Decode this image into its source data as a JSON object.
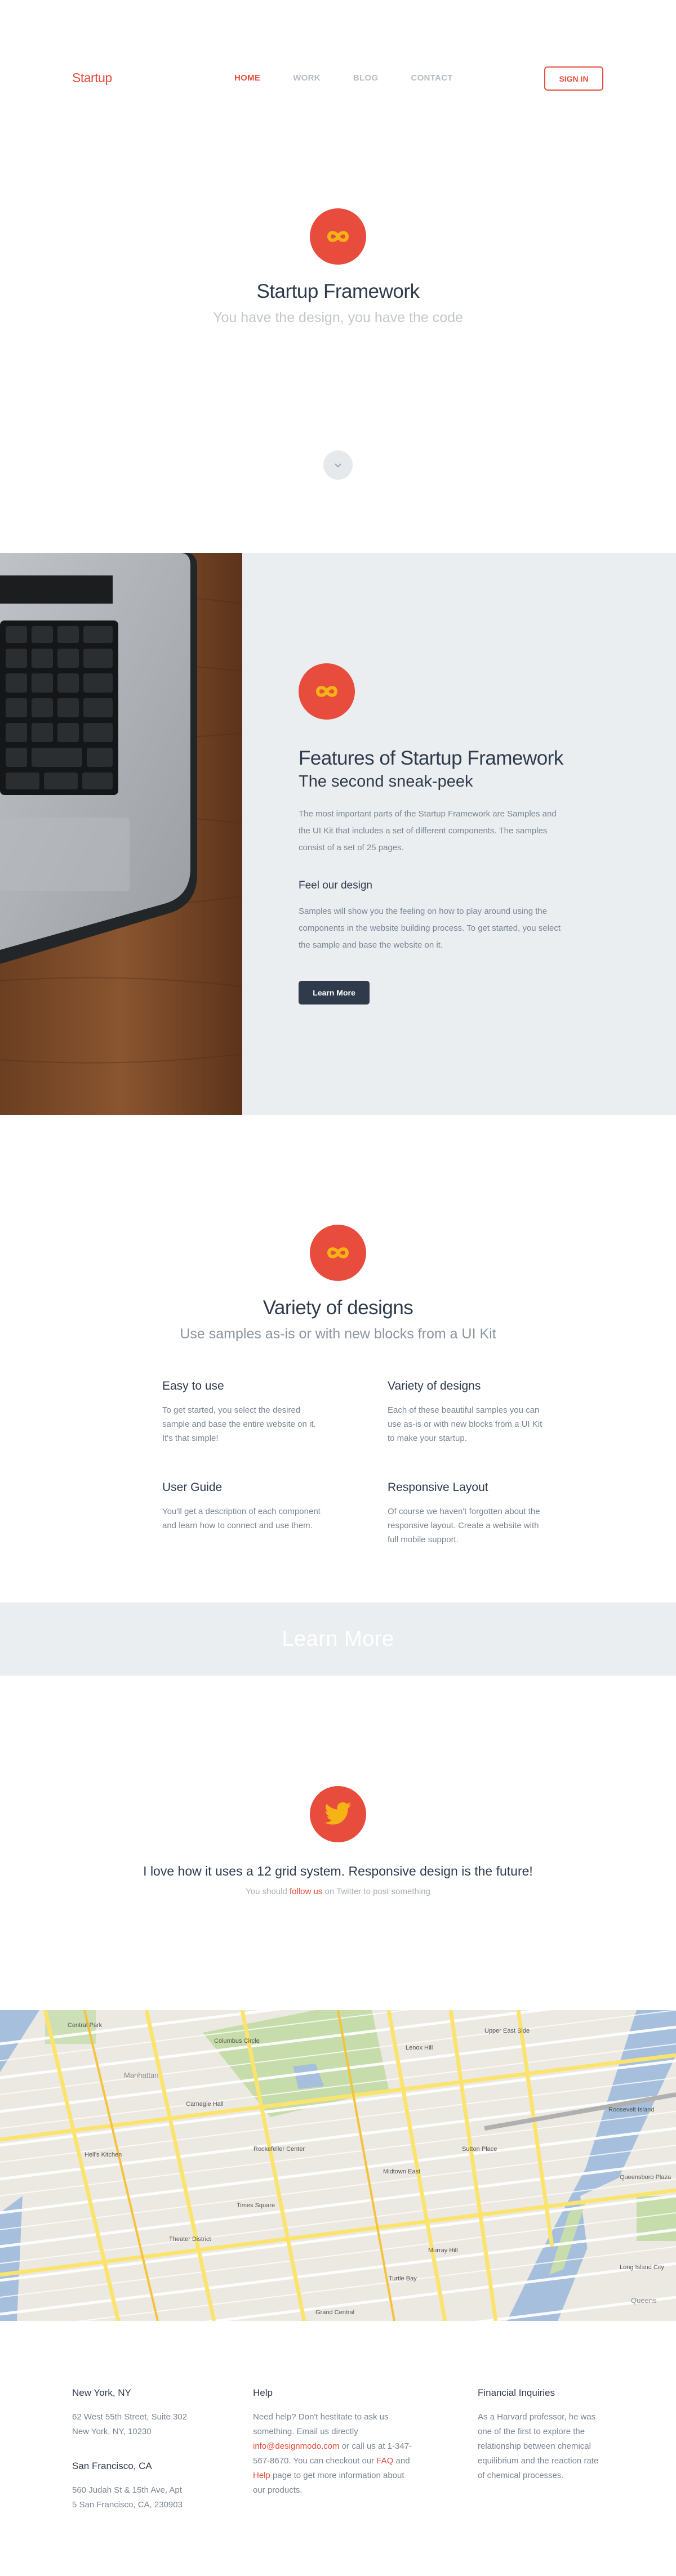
{
  "header": {
    "logo": "Startup",
    "nav": [
      "HOME",
      "WORK",
      "BLOG",
      "CONTACT"
    ],
    "signin_label": "SIGN IN"
  },
  "hero": {
    "icon": "infinity-icon",
    "title": "Startup Framework",
    "subtitle": "You have the design, you have the code",
    "scroll_icon": "chevron-down-icon"
  },
  "features": {
    "image": "laptop-on-wood-photo",
    "icon": "infinity-icon",
    "title": "Features of Startup Framework",
    "subtitle": "The second sneak-peek",
    "paragraph": "The most important parts of the Startup Framework are Samples and the UI Kit that includes a set of different components. The samples consist of a set of 25 pages.",
    "heading2": "Feel our design",
    "paragraph2": "Samples will show you the feeling on how to play around using the components in the website building process. To get started, you select the sample and base the website on it.",
    "button_label": "Learn More"
  },
  "variety": {
    "icon": "infinity-icon",
    "title": "Variety of designs",
    "subtitle": "Use samples as-is or with new blocks from a UI Kit",
    "items": [
      {
        "title": "Easy to use",
        "text": "To get started, you select the desired sample and base the entire website on it. It's that simple!"
      },
      {
        "title": "Variety of designs",
        "text": "Each of these beautiful samples you can use as-is or with new blocks from a UI Kit to make your startup."
      },
      {
        "title": "User Guide",
        "text": "You'll get a description of each component and learn how to connect and use them."
      },
      {
        "title": "Responsive Layout",
        "text": "Of course we haven't forgotten about the responsive layout. Create a website with full mobile support."
      }
    ]
  },
  "learn_more_band": "Learn More",
  "twitter": {
    "icon": "twitter-bird-icon",
    "quote": "I love how it uses a 12 grid system. Responsive design is the future!",
    "sub_prefix": "You should ",
    "sub_link": "follow us",
    "sub_suffix": " on Twitter to post something"
  },
  "map": {
    "labels": [
      "Central Park",
      "Columbus Circle",
      "Carnegie Hall",
      "Times Square",
      "Roosevelt Island",
      "Sutton Place",
      "Lenox Hill",
      "Upper East Side",
      "Hell's Kitchen",
      "Midtown East",
      "Theater District",
      "Grand Central",
      "Murray Hill",
      "Queensboro Plaza",
      "Long Island City",
      "Turtle Bay",
      "Rockefeller Center",
      "Manhattan",
      "Queens"
    ]
  },
  "footer": {
    "ny": {
      "title": "New York, NY",
      "lines": [
        "62 West 55th Street, Suite 302",
        "New York, NY, 10230"
      ]
    },
    "sf": {
      "title": "San Francisco, CA",
      "lines": [
        "560 Judah St & 15th Ave, Apt",
        "5 San Francisco, CA, 230903"
      ]
    },
    "help": {
      "title": "Help",
      "t1": "Need help? Don't hestitate to ask us something. Email us directly",
      "email": "info@designmodo.com",
      "t2": " or call us at 1-347-567-8670. You can checkout our",
      "faq": "FAQ",
      "and": " and ",
      "help_link": "Help",
      "t3": " page to get more information about our products."
    },
    "finance": {
      "title": "Financial Inquiries",
      "text": "As a Harvard professor, he was one of the first to explore the relationship between chemical equilibrium and the reaction rate of chemical processes."
    }
  },
  "colors": {
    "accent": "#e74c3c",
    "dark": "#2f3a4b",
    "muted": "#7b8592",
    "light_bg": "#ebeef0"
  }
}
